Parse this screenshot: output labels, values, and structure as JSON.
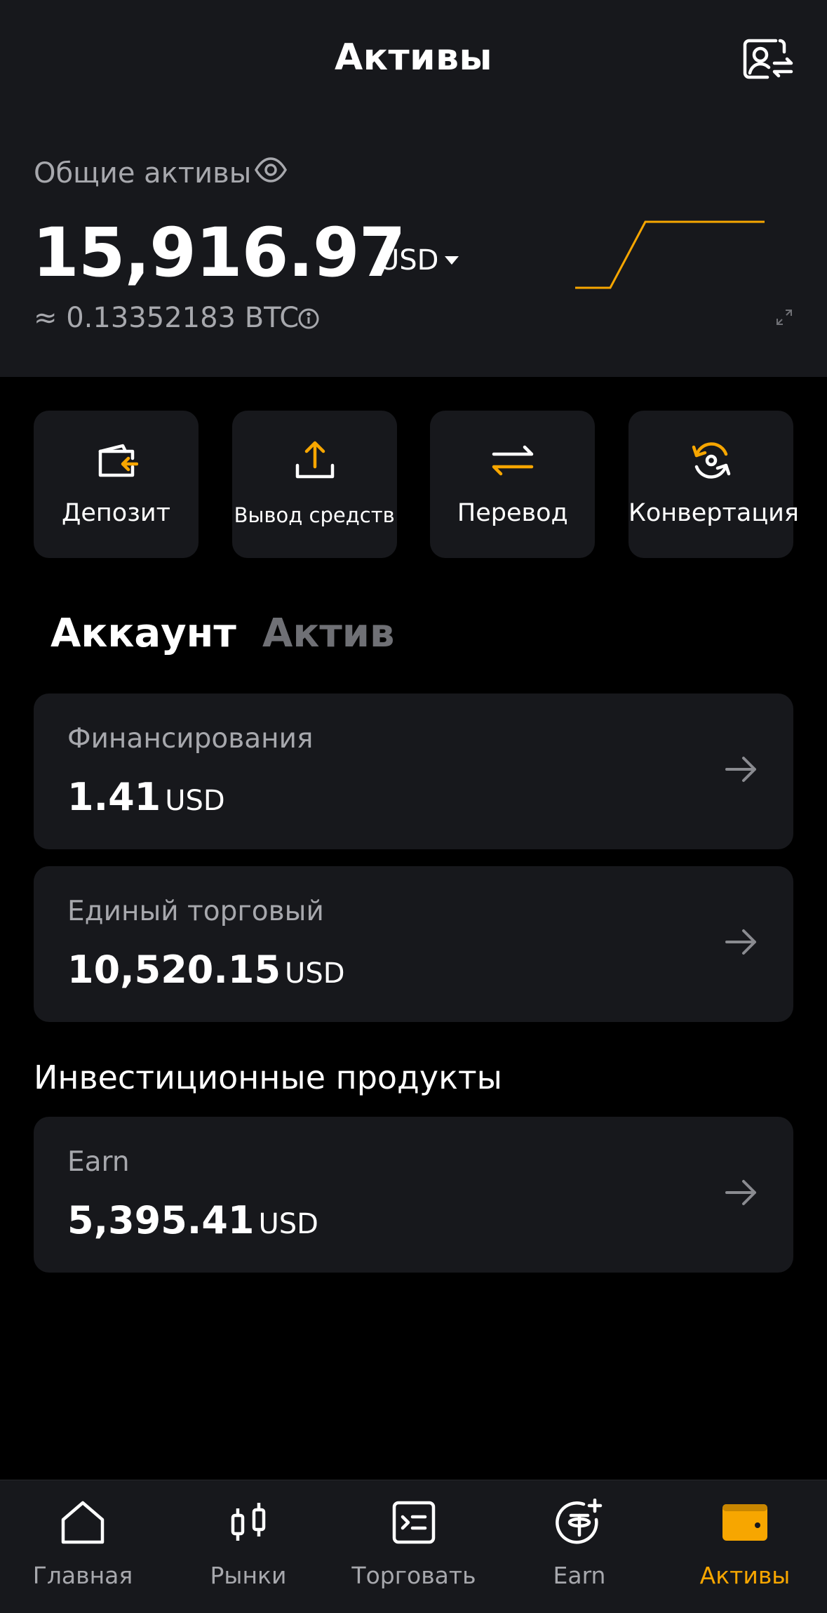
{
  "colors": {
    "accent": "#f7a600",
    "header_bg": "#17181c",
    "card_bg": "#17181c",
    "page_bg": "#000000",
    "muted_text": "#a7a8ad",
    "inactive_tab": "#6f7075"
  },
  "header": {
    "title": "Активы",
    "profile_icon": "user-switch-icon"
  },
  "summary": {
    "label": "Общие активы",
    "total": "15,916.97",
    "currency": "USD",
    "btc_equivalent": "≈ 0.13352183 BTC",
    "sparkline": [
      0,
      0,
      1,
      1,
      1
    ]
  },
  "actions": [
    {
      "label": "Депозит",
      "icon": "wallet-deposit-icon"
    },
    {
      "label": "Вывод средств",
      "icon": "upload-icon"
    },
    {
      "label": "Перевод",
      "icon": "transfer-arrows-icon"
    },
    {
      "label": "Конвертация",
      "icon": "convert-icon"
    }
  ],
  "tabs": [
    {
      "label": "Аккаунт",
      "active": true
    },
    {
      "label": "Актив",
      "active": false
    }
  ],
  "accounts": [
    {
      "title": "Финансирования",
      "amount": "1.41",
      "unit": "USD"
    },
    {
      "title": "Единый торговый",
      "amount": "10,520.15",
      "unit": "USD"
    }
  ],
  "investments": {
    "title": "Инвестиционные продукты",
    "items": [
      {
        "title": "Earn",
        "amount": "5,395.41",
        "unit": "USD"
      }
    ]
  },
  "nav": [
    {
      "label": "Главная",
      "icon": "home-icon",
      "active": false
    },
    {
      "label": "Рынки",
      "icon": "candlestick-icon",
      "active": false
    },
    {
      "label": "Торговать",
      "icon": "trade-terminal-icon",
      "active": false
    },
    {
      "label": "Earn",
      "icon": "earn-coin-icon",
      "active": false
    },
    {
      "label": "Активы",
      "icon": "wallet-icon",
      "active": true
    }
  ]
}
